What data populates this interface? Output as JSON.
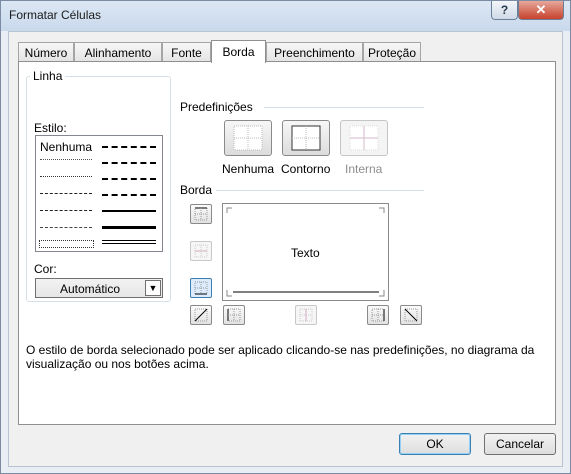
{
  "window": {
    "title": "Formatar Células",
    "help_icon": "question-mark-icon",
    "close_icon": "close-x-icon"
  },
  "tabs": [
    {
      "label": "Número"
    },
    {
      "label": "Alinhamento"
    },
    {
      "label": "Fonte"
    },
    {
      "label": "Borda",
      "active": true
    },
    {
      "label": "Preenchimento"
    },
    {
      "label": "Proteção"
    }
  ],
  "line_group": {
    "title": "Linha",
    "style_label": "Estilo:",
    "none_option": "Nenhuma",
    "color_label": "Cor:",
    "color_value": "Automático"
  },
  "presets": {
    "title": "Predefinições",
    "items": [
      {
        "label": "Nenhuma",
        "enabled": true
      },
      {
        "label": "Contorno",
        "enabled": true
      },
      {
        "label": "Interna",
        "enabled": false
      }
    ]
  },
  "border": {
    "title": "Borda",
    "preview_text": "Texto"
  },
  "description": "O estilo de borda selecionado pode ser aplicado clicando-se nas predefinições, no diagrama da visualização ou nos botões acima.",
  "buttons": {
    "ok": "OK",
    "cancel": "Cancelar"
  },
  "colors": {
    "accent": "#3c7fb1",
    "close": "#c7422c"
  }
}
